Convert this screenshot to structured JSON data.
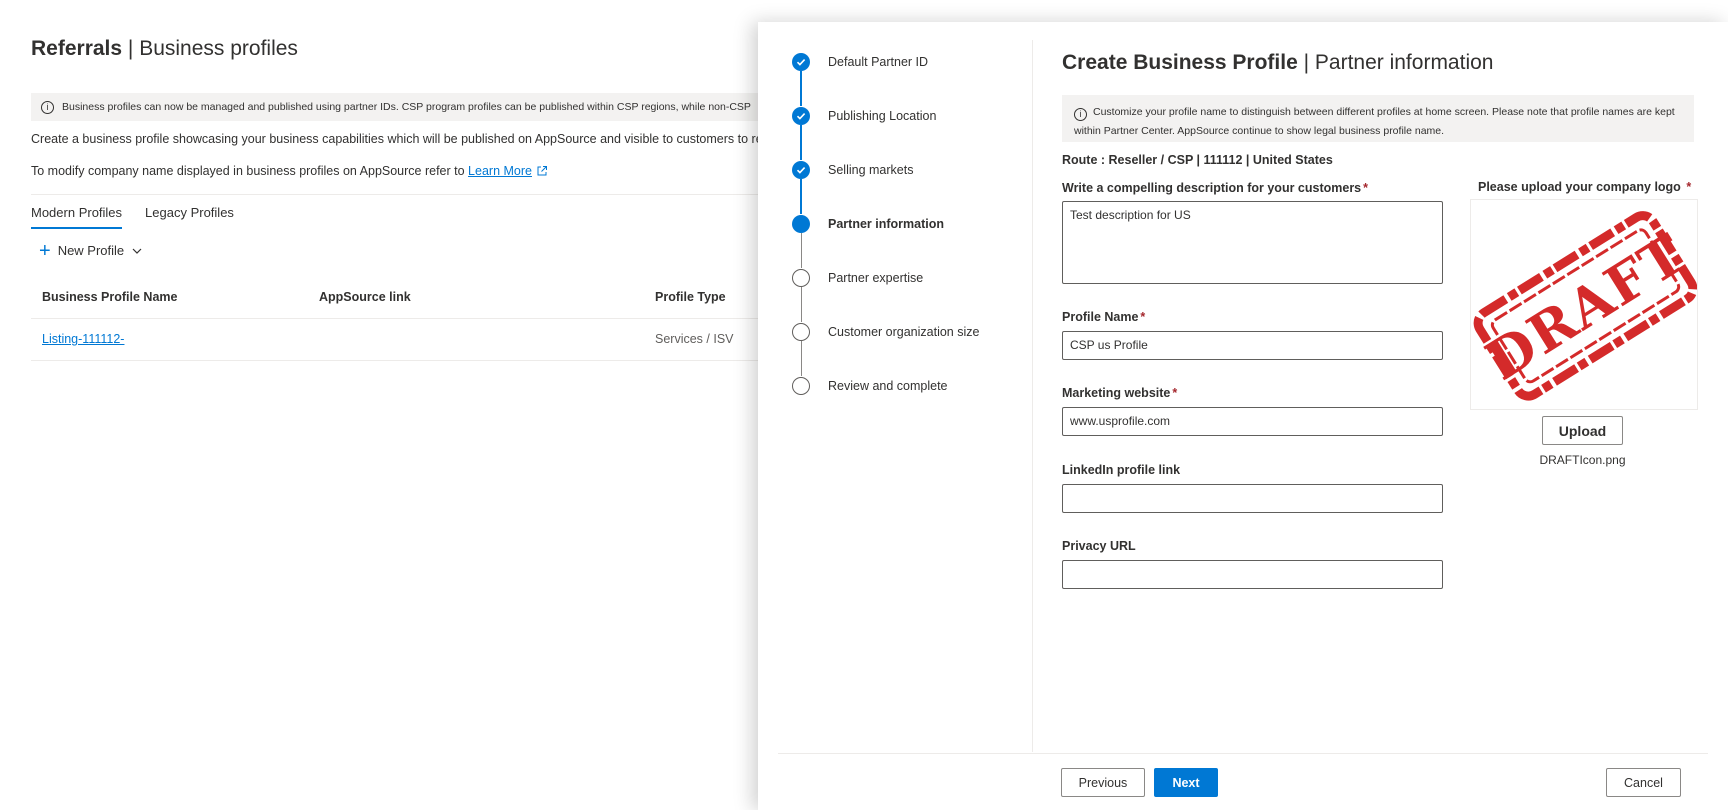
{
  "background": {
    "title_bold": "Referrals",
    "title_sep": " | ",
    "title_rest": "Business profiles",
    "info_text": "Business profiles can now be managed and published using partner IDs. CSP program profiles can be published within CSP regions, while non-CSP",
    "description": "Create a business profile showcasing your business capabilities which will be published on AppSource and visible to customers to re",
    "modify_text": "To modify company name displayed in business profiles on AppSource refer to ",
    "learn_more": "Learn More",
    "tabs": [
      "Modern Profiles",
      "Legacy Profiles"
    ],
    "new_profile_label": "New Profile",
    "table": {
      "headers": [
        "Business Profile Name",
        "AppSource link",
        "Profile Type"
      ],
      "rows": [
        {
          "name": "Listing-111112-",
          "appsource": "",
          "type": "Services / ISV"
        }
      ]
    }
  },
  "panel": {
    "steps": [
      {
        "label": "Default Partner ID",
        "status": "done"
      },
      {
        "label": "Publishing Location",
        "status": "done"
      },
      {
        "label": "Selling markets",
        "status": "done"
      },
      {
        "label": "Partner information",
        "status": "current"
      },
      {
        "label": "Partner expertise",
        "status": "todo"
      },
      {
        "label": "Customer organization size",
        "status": "todo"
      },
      {
        "label": "Review and complete",
        "status": "todo"
      }
    ],
    "title_bold": "Create Business Profile",
    "title_sep": " | ",
    "title_rest": "Partner information",
    "info_text": "Customize your profile name to distinguish between different profiles at home screen. Please note that profile names are kept within Partner Center. AppSource continue to show legal business profile name.",
    "route": "Route : Reseller / CSP | 111112 | United States",
    "fields": {
      "description": {
        "label": "Write a compelling description for your customers",
        "required": "*",
        "value": "Test description for US"
      },
      "profile_name": {
        "label": "Profile Name",
        "required": "*",
        "value": "CSP us Profile"
      },
      "marketing_website": {
        "label": "Marketing website",
        "required": "*",
        "value": "www.usprofile.com"
      },
      "linkedin": {
        "label": "LinkedIn profile link",
        "value": ""
      },
      "privacy_url": {
        "label": "Privacy URL",
        "value": ""
      }
    },
    "logo": {
      "label": "Please upload your company logo",
      "required": "*",
      "stamp_text": "DRAFT",
      "upload_label": "Upload",
      "file_name": "DRAFTIcon.png"
    },
    "buttons": {
      "previous": "Previous",
      "next": "Next",
      "cancel": "Cancel"
    },
    "colors": {
      "accent": "#0078d4",
      "stamp": "#d42a2a",
      "required": "#a4262c"
    }
  }
}
